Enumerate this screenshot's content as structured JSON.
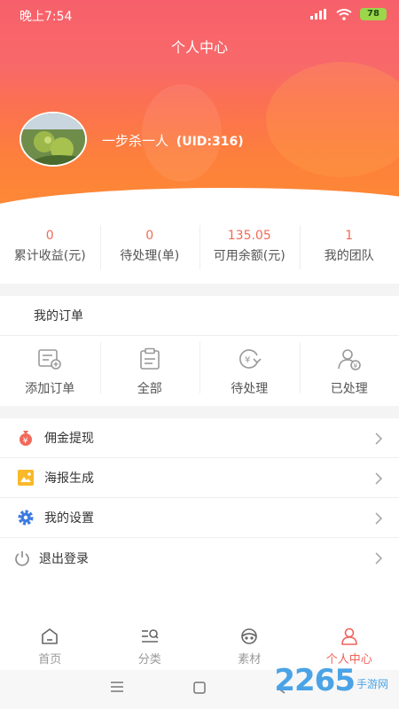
{
  "status_bar": {
    "time": "晚上7:54",
    "battery": "78"
  },
  "header": {
    "title": "个人中心"
  },
  "profile": {
    "name": "一步杀一人",
    "uid": "(UID:316)"
  },
  "stats": [
    {
      "value": "0",
      "label": "累计收益(元)"
    },
    {
      "value": "0",
      "label": "待处理(单)"
    },
    {
      "value": "135.05",
      "label": "可用余额(元)"
    },
    {
      "value": "1",
      "label": "我的团队"
    }
  ],
  "orders": {
    "title": "我的订单",
    "items": [
      {
        "label": "添加订单",
        "icon": "add-order-icon"
      },
      {
        "label": "全部",
        "icon": "clipboard-icon"
      },
      {
        "label": "待处理",
        "icon": "yen-refresh-icon"
      },
      {
        "label": "已处理",
        "icon": "user-yen-icon"
      }
    ]
  },
  "menu": [
    {
      "label": "佣金提现",
      "icon": "money-bag-icon"
    },
    {
      "label": "海报生成",
      "icon": "poster-icon"
    },
    {
      "label": "我的设置",
      "icon": "gear-icon"
    },
    {
      "label": "退出登录",
      "icon": "power-icon"
    }
  ],
  "tabbar": [
    {
      "label": "首页",
      "icon": "home-icon",
      "active": false
    },
    {
      "label": "分类",
      "icon": "category-search-icon",
      "active": false
    },
    {
      "label": "素材",
      "icon": "material-icon",
      "active": false
    },
    {
      "label": "个人中心",
      "icon": "person-icon",
      "active": true
    }
  ],
  "watermark": {
    "number": "2265",
    "text": "手游网"
  },
  "colors": {
    "accent": "#f36a57",
    "header_top": "#f7606a",
    "header_bottom": "#fd8a34"
  }
}
